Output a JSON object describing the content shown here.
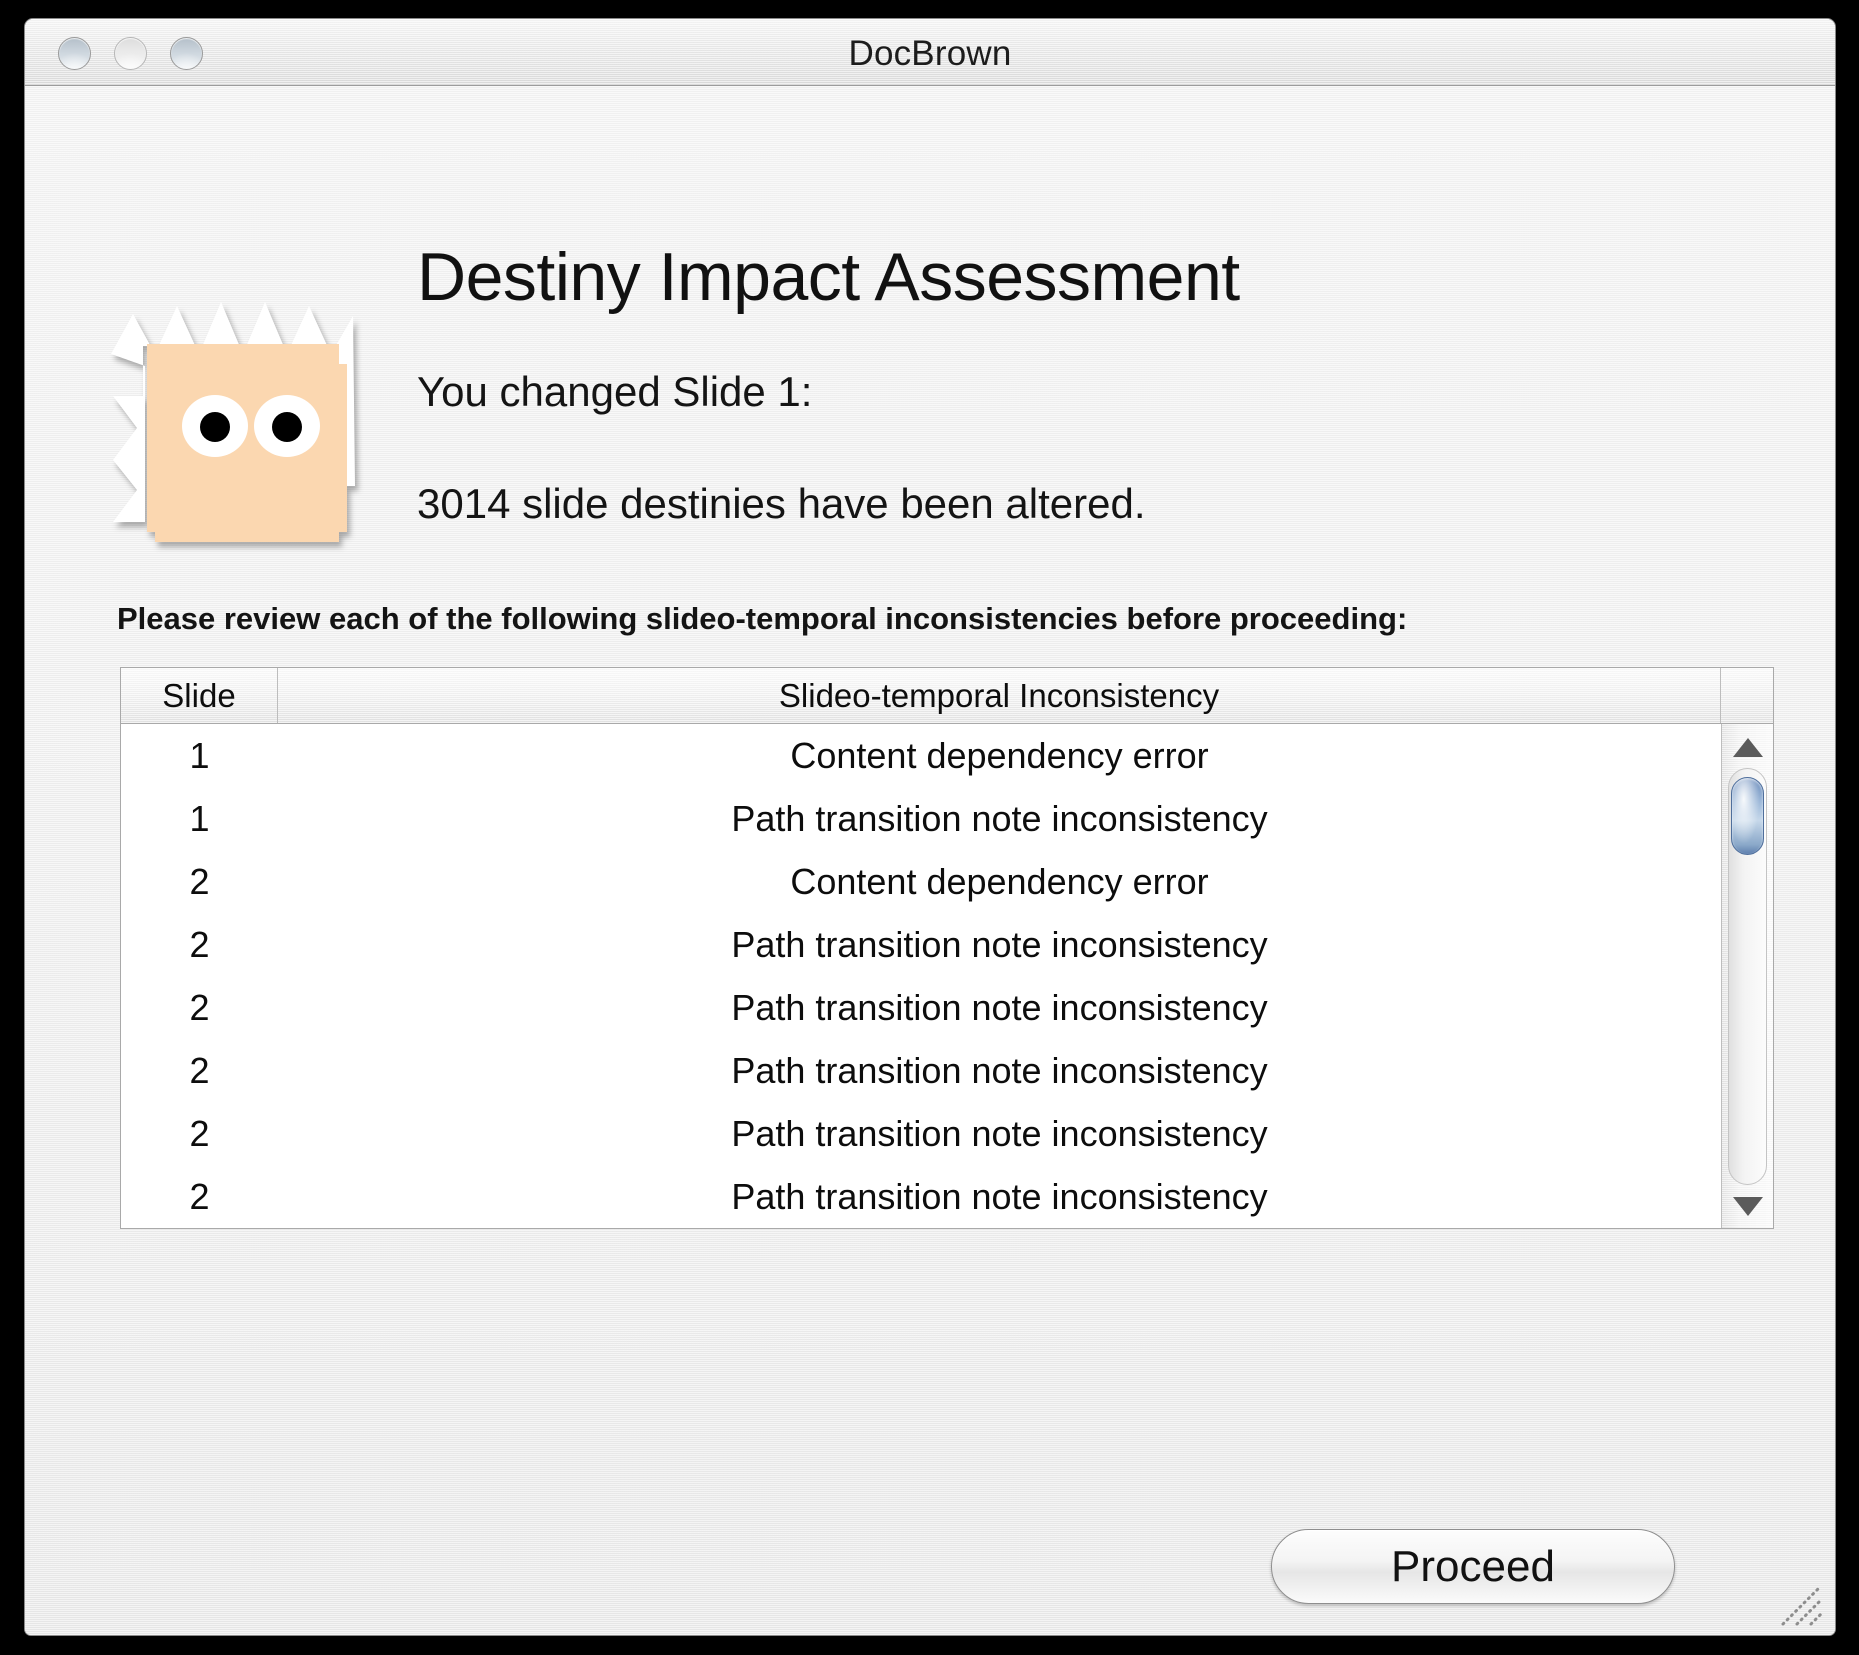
{
  "window": {
    "title": "DocBrown",
    "traffic_lights": [
      "close",
      "minimize",
      "zoom"
    ]
  },
  "dialog": {
    "headline": "Destiny Impact Assessment",
    "subline_1": "You changed Slide 1:",
    "subline_2": "3014 slide destinies have been altered.",
    "instruction": "Please review each of the following slideo-temporal inconsistencies before proceeding:",
    "icon_name": "doc-brown-face-icon"
  },
  "table": {
    "columns": [
      "Slide",
      "Slideo-temporal Inconsistency"
    ],
    "rows": [
      {
        "slide": "1",
        "inconsistency": "Content dependency error"
      },
      {
        "slide": "1",
        "inconsistency": "Path transition note inconsistency"
      },
      {
        "slide": "2",
        "inconsistency": "Content dependency error"
      },
      {
        "slide": "2",
        "inconsistency": "Path transition note inconsistency"
      },
      {
        "slide": "2",
        "inconsistency": "Path transition note inconsistency"
      },
      {
        "slide": "2",
        "inconsistency": "Path transition note inconsistency"
      },
      {
        "slide": "2",
        "inconsistency": "Path transition note inconsistency"
      },
      {
        "slide": "2",
        "inconsistency": "Path transition note inconsistency"
      }
    ]
  },
  "scrollbar": {
    "up_arrow": "scroll-up-arrow",
    "down_arrow": "scroll-down-arrow",
    "thumb": "scroll-thumb"
  },
  "buttons": {
    "proceed": "Proceed"
  },
  "colors": {
    "window_background": "#ededed",
    "title_text": "#1c1c1c",
    "body_text": "#141414",
    "table_background": "#ffffff",
    "scroll_thumb_blue": "#6f8fbd",
    "icon_face": "#fbd7b0",
    "icon_hair": "#ffffff",
    "icon_eye": "#000000"
  }
}
